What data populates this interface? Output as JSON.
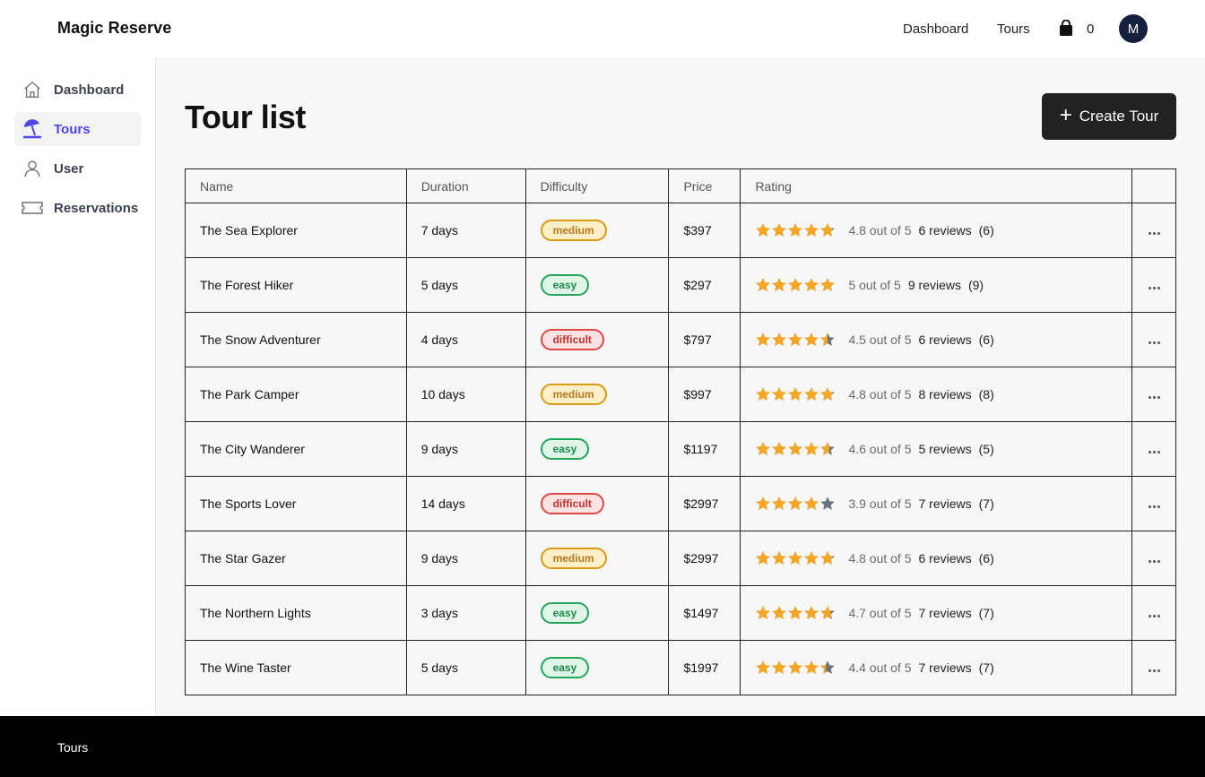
{
  "header": {
    "brand": "Magic Reserve",
    "nav": [
      "Dashboard",
      "Tours"
    ],
    "cart_count": "0",
    "avatar_initial": "M"
  },
  "sidebar": {
    "items": [
      {
        "label": "Dashboard",
        "icon": "home-icon"
      },
      {
        "label": "Tours",
        "icon": "beach-umbrella-icon"
      },
      {
        "label": "User",
        "icon": "user-icon"
      },
      {
        "label": "Reservations",
        "icon": "ticket-icon"
      }
    ],
    "active": "Tours"
  },
  "main": {
    "title": "Tour list",
    "create_label": "Create Tour"
  },
  "table": {
    "columns": [
      "Name",
      "Duration",
      "Difficulty",
      "Price",
      "Rating",
      ""
    ],
    "rows": [
      {
        "name": "The Sea Explorer",
        "duration": "7 days",
        "difficulty": "medium",
        "price": "$397",
        "rating": 4.8,
        "rating_text": "4.8 out of 5",
        "reviews": "6 reviews",
        "count": "(6)"
      },
      {
        "name": "The Forest Hiker",
        "duration": "5 days",
        "difficulty": "easy",
        "price": "$297",
        "rating": 5,
        "rating_text": "5 out of 5",
        "reviews": "9 reviews",
        "count": "(9)"
      },
      {
        "name": "The Snow Adventurer",
        "duration": "4 days",
        "difficulty": "difficult",
        "price": "$797",
        "rating": 4.5,
        "rating_text": "4.5 out of 5",
        "reviews": "6 reviews",
        "count": "(6)"
      },
      {
        "name": "The Park Camper",
        "duration": "10 days",
        "difficulty": "medium",
        "price": "$997",
        "rating": 4.8,
        "rating_text": "4.8 out of 5",
        "reviews": "8 reviews",
        "count": "(8)"
      },
      {
        "name": "The City Wanderer",
        "duration": "9 days",
        "difficulty": "easy",
        "price": "$1197",
        "rating": 4.6,
        "rating_text": "4.6 out of 5",
        "reviews": "5 reviews",
        "count": "(5)"
      },
      {
        "name": "The Sports Lover",
        "duration": "14 days",
        "difficulty": "difficult",
        "price": "$2997",
        "rating": 3.9,
        "rating_text": "3.9 out of 5",
        "reviews": "7 reviews",
        "count": "(7)"
      },
      {
        "name": "The Star Gazer",
        "duration": "9 days",
        "difficulty": "medium",
        "price": "$2997",
        "rating": 4.8,
        "rating_text": "4.8 out of 5",
        "reviews": "6 reviews",
        "count": "(6)"
      },
      {
        "name": "The Northern Lights",
        "duration": "3 days",
        "difficulty": "easy",
        "price": "$1497",
        "rating": 4.7,
        "rating_text": "4.7 out of 5",
        "reviews": "7 reviews",
        "count": "(7)"
      },
      {
        "name": "The Wine Taster",
        "duration": "5 days",
        "difficulty": "easy",
        "price": "$1997",
        "rating": 4.4,
        "rating_text": "4.4 out of 5",
        "reviews": "7 reviews",
        "count": "(7)"
      }
    ]
  },
  "footer": {
    "text": "Tours"
  },
  "colors": {
    "accent": "#4f46e5",
    "star_filled": "#f5a623",
    "star_empty": "#6b7280"
  }
}
